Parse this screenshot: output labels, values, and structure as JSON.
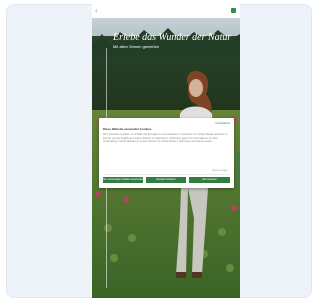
{
  "page": {
    "headline": "Erlebe das Wunder der Natur",
    "subline": "Mit allen Sinnen genießen"
  },
  "cookie_modal": {
    "brand": "Cookiebot",
    "title": "Diese Website verwendet Cookies",
    "body": "Wir verwenden Cookies, um Inhalte und Anzeigen zu personalisieren, Funktionen für soziale Medien anbieten zu können und die Zugriffe auf unsere Website zu analysieren. Außerdem geben wir Informationen zu Ihrer Verwendung unserer Website an unsere Partner für soziale Medien, Werbung und Analysen weiter.",
    "details_link": "Details zeigen",
    "buttons": {
      "deny": "Nur notwendige Cookies verwenden",
      "allow_selection": "Auswahl erlauben",
      "allow_all": "Alle zulassen"
    }
  },
  "colors": {
    "accent": "#2f7f43",
    "card_bg": "#eef3f9"
  },
  "icons": {
    "back": "chevron-left-icon",
    "status": "square-icon"
  }
}
